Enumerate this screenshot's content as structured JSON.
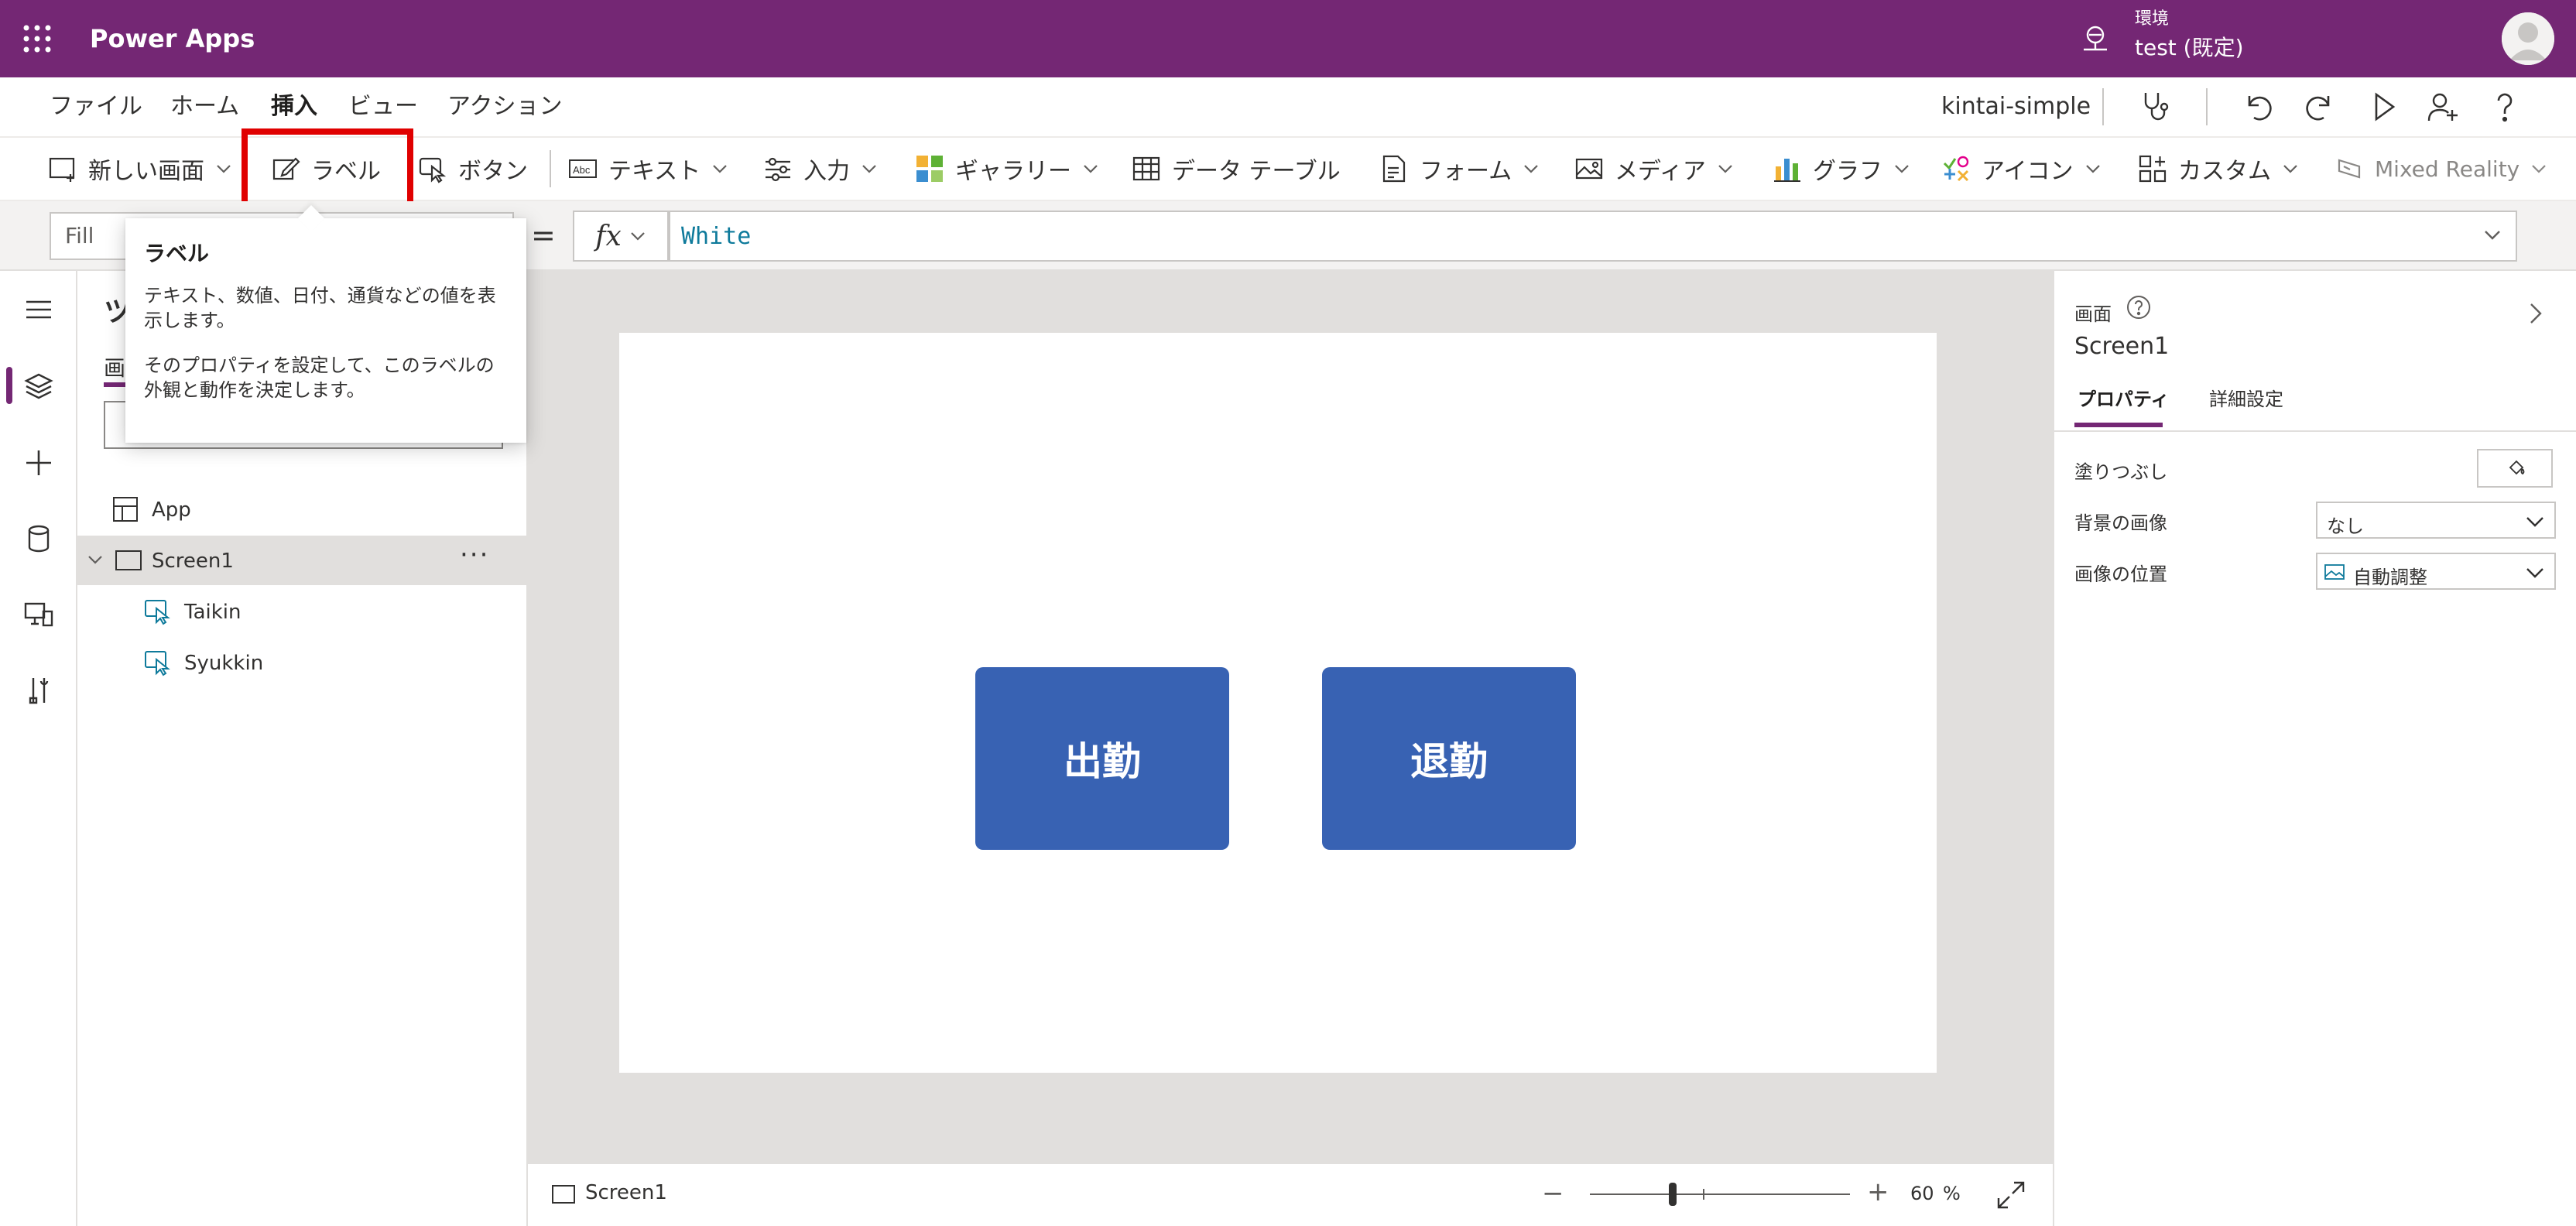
{
  "header": {
    "app_title": "Power Apps",
    "environment_label": "環境",
    "environment_name": "test (既定)"
  },
  "menu": {
    "items": [
      "ファイル",
      "ホーム",
      "挿入",
      "ビュー",
      "アクション"
    ],
    "active": "挿入",
    "app_name": "kintai-simple"
  },
  "ribbon": {
    "new_screen": "新しい画面",
    "label": "ラベル",
    "button": "ボタン",
    "text": "テキスト",
    "input": "入力",
    "gallery": "ギャラリー",
    "data_table": "データ テーブル",
    "form": "フォーム",
    "media": "メディア",
    "chart": "グラフ",
    "icons": "アイコン",
    "custom": "カスタム",
    "mixed_reality": "Mixed Reality"
  },
  "formula": {
    "property": "Fill",
    "equals": "=",
    "fx": "fx",
    "value": "White"
  },
  "tooltip": {
    "title": "ラベル",
    "body1": "テキスト、数値、日付、通貨などの値を表示します。",
    "body2": "そのプロパティを設定して、このラベルの外観と動作を決定します。"
  },
  "tree": {
    "title": "ツ",
    "tab": "画",
    "items": [
      {
        "label": "App"
      },
      {
        "label": "Screen1"
      },
      {
        "label": "Taikin"
      },
      {
        "label": "Syukkin"
      }
    ],
    "more": "···"
  },
  "canvas": {
    "buttons": [
      {
        "text": "出勤"
      },
      {
        "text": "退勤"
      }
    ],
    "button_color": "#3862b3"
  },
  "statusbar": {
    "screen_name": "Screen1",
    "zoom_minus": "−",
    "zoom_plus": "+",
    "zoom_value": "60",
    "zoom_unit": "%"
  },
  "properties": {
    "type_label": "画面",
    "name": "Screen1",
    "tabs": [
      "プロパティ",
      "詳細設定"
    ],
    "fill_label": "塗りつぶし",
    "bg_image_label": "背景の画像",
    "bg_image_value": "なし",
    "image_position_label": "画像の位置",
    "image_position_value": "自動調整"
  },
  "colors": {
    "header": "#742774",
    "accent": "#742774",
    "highlight": "#e00000"
  }
}
